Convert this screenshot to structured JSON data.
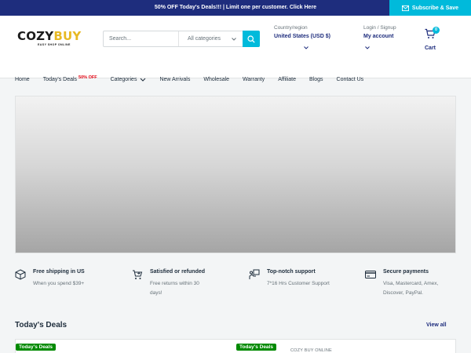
{
  "announcement": {
    "text": "50% OFF Today's Deals!!! | Limit one per customer. Click Here"
  },
  "subscribe": {
    "label": "Subscribe & Save",
    "icon": "mail-icon"
  },
  "logo": {
    "word_part1": "COZY",
    "word_part2": "BUY",
    "tagline": "EASY SHOP ONLINE"
  },
  "search": {
    "placeholder": "Search...",
    "category_label": "All categories",
    "button_icon": "search-icon"
  },
  "country": {
    "label": "Country/region",
    "value": "United States (USD $)"
  },
  "account": {
    "label": "Login / Signup",
    "value": "My account"
  },
  "cart": {
    "count": "0",
    "label": "Cart",
    "icon": "cart-icon"
  },
  "nav": {
    "home": "Home",
    "deals": "Today's Deals",
    "deals_badge": "50% OFF",
    "categories": "Categories",
    "new_arrivals": "New Arrivals",
    "wholesale": "Wholesale",
    "warranty": "Warranty",
    "affiliate": "Affiliate",
    "blogs": "Blogs",
    "contact": "Contact Us"
  },
  "features": [
    {
      "title": "Free shipping in US",
      "desc": "When you spend $39+",
      "icon": "box-icon"
    },
    {
      "title": "Satisfied or refunded",
      "desc": "Free returns within 30 days!",
      "icon": "refund-cart-icon"
    },
    {
      "title": "Top-notch support",
      "desc": "7*16 Hrs Customer Support",
      "icon": "support-icon"
    },
    {
      "title": "Secure payments",
      "desc": "Visa, Mastercard, Amex, Discover, PayPal.",
      "icon": "credit-card-icon"
    }
  ],
  "deals_section": {
    "title": "Today's Deals",
    "view_all": "View all",
    "badge": "Today's Deals",
    "vendor": "COZY BUY ONLINE"
  },
  "colors": {
    "navy": "#1e2d7d",
    "accent": "#00badb",
    "deal_green": "#008a00",
    "sale_red": "#e1000f"
  }
}
